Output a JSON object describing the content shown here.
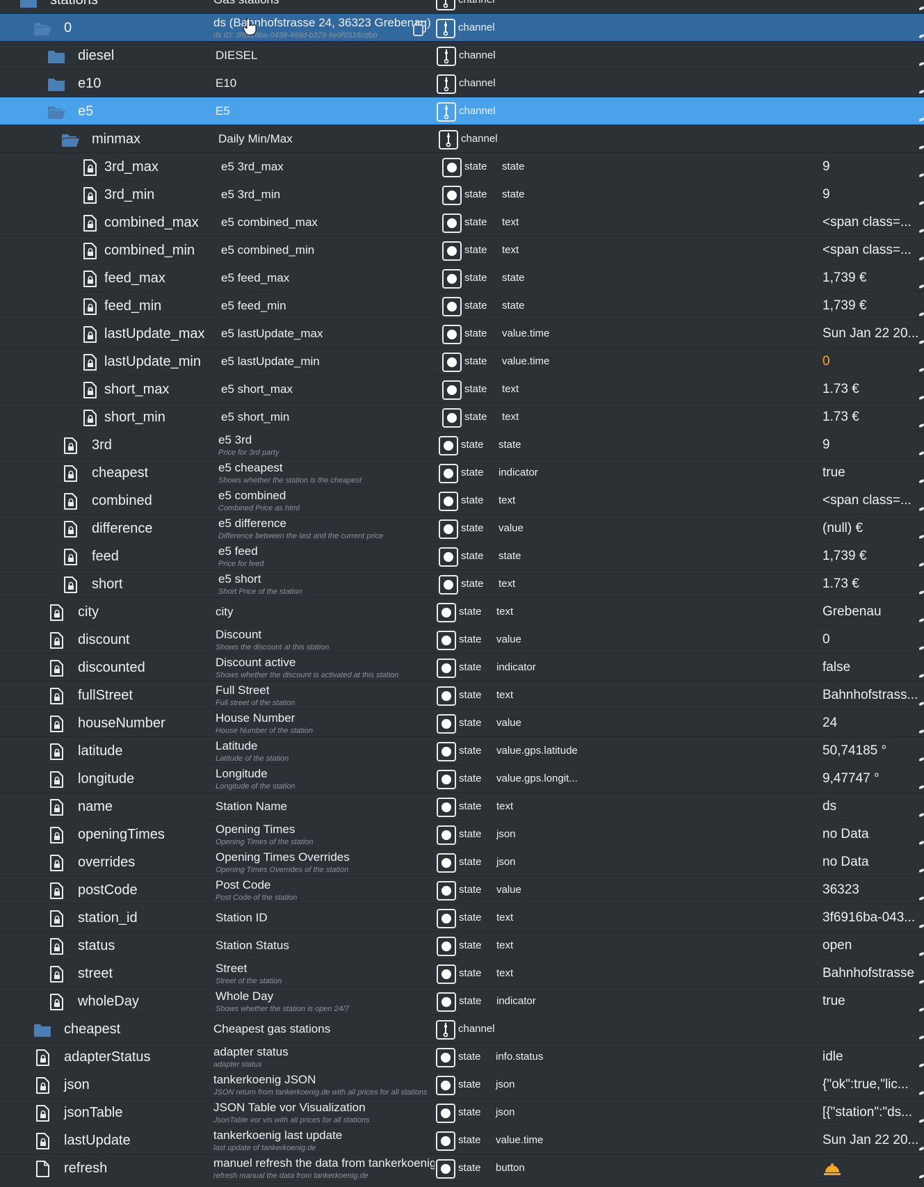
{
  "copy_icon": "copy-icon",
  "rows": [
    {
      "kind": "folder",
      "name": "stations",
      "title": "Gas stations",
      "desc": "",
      "role_type": "channel",
      "role": "",
      "value": "",
      "indent": 0
    },
    {
      "kind": "folder-open",
      "name": "0",
      "title": "ds (Bahnhofstrasse 24, 36323 Grebenau)",
      "desc": "ds ID: 3f6916ba-0438-469d-b379-6e9f0516cdbb",
      "role_type": "channel",
      "role": "",
      "value": "",
      "indent": 1,
      "selected": "dark"
    },
    {
      "kind": "folder",
      "name": "diesel",
      "title": "DIESEL",
      "desc": "",
      "role_type": "channel",
      "role": "",
      "value": "",
      "indent": 2
    },
    {
      "kind": "folder",
      "name": "e10",
      "title": "E10",
      "desc": "",
      "role_type": "channel",
      "role": "",
      "value": "",
      "indent": 2
    },
    {
      "kind": "folder-open",
      "name": "e5",
      "title": "E5",
      "desc": "",
      "role_type": "channel",
      "role": "",
      "value": "",
      "indent": 2,
      "selected": "light"
    },
    {
      "kind": "folder-open",
      "name": "minmax",
      "title": "Daily Min/Max",
      "desc": "",
      "role_type": "channel",
      "role": "",
      "value": "",
      "indent": 3
    },
    {
      "kind": "state",
      "name": "3rd_max",
      "title": "e5 3rd_max",
      "desc": "",
      "role_type": "state",
      "role": "state",
      "value": "9",
      "indent": 4
    },
    {
      "kind": "state",
      "name": "3rd_min",
      "title": "e5 3rd_min",
      "desc": "",
      "role_type": "state",
      "role": "state",
      "value": "9",
      "indent": 4
    },
    {
      "kind": "state",
      "name": "combined_max",
      "title": "e5 combined_max",
      "desc": "",
      "role_type": "state",
      "role": "text",
      "value": "<span class=...",
      "indent": 4
    },
    {
      "kind": "state",
      "name": "combined_min",
      "title": "e5 combined_min",
      "desc": "",
      "role_type": "state",
      "role": "text",
      "value": "<span class=...",
      "indent": 4
    },
    {
      "kind": "state",
      "name": "feed_max",
      "title": "e5 feed_max",
      "desc": "",
      "role_type": "state",
      "role": "state",
      "value": "1,739 €",
      "indent": 4
    },
    {
      "kind": "state",
      "name": "feed_min",
      "title": "e5 feed_min",
      "desc": "",
      "role_type": "state",
      "role": "state",
      "value": "1,739 €",
      "indent": 4
    },
    {
      "kind": "state",
      "name": "lastUpdate_max",
      "title": "e5 lastUpdate_max",
      "desc": "",
      "role_type": "state",
      "role": "value.time",
      "value": "Sun Jan 22 20...",
      "indent": 4
    },
    {
      "kind": "state",
      "name": "lastUpdate_min",
      "title": "e5 lastUpdate_min",
      "desc": "",
      "role_type": "state",
      "role": "value.time",
      "value": "0",
      "indent": 4,
      "value_color": "orange"
    },
    {
      "kind": "state",
      "name": "short_max",
      "title": "e5 short_max",
      "desc": "",
      "role_type": "state",
      "role": "text",
      "value": "1.73 €",
      "indent": 4
    },
    {
      "kind": "state",
      "name": "short_min",
      "title": "e5 short_min",
      "desc": "",
      "role_type": "state",
      "role": "text",
      "value": "1.73 €",
      "indent": 4
    },
    {
      "kind": "state",
      "name": "3rd",
      "title": "e5 3rd",
      "desc": "Price for 3rd party",
      "role_type": "state",
      "role": "state",
      "value": "9",
      "indent": 3
    },
    {
      "kind": "state",
      "name": "cheapest",
      "title": "e5 cheapest",
      "desc": "Shows whether the station is the cheapest",
      "role_type": "state",
      "role": "indicator",
      "value": "true",
      "indent": 3
    },
    {
      "kind": "state",
      "name": "combined",
      "title": "e5 combined",
      "desc": "Combined Price as html",
      "role_type": "state",
      "role": "text",
      "value": "<span class=...",
      "indent": 3
    },
    {
      "kind": "state",
      "name": "difference",
      "title": "e5 difference",
      "desc": "Difference between the last and the current price",
      "role_type": "state",
      "role": "value",
      "value": "(null) €",
      "indent": 3
    },
    {
      "kind": "state",
      "name": "feed",
      "title": "e5 feed",
      "desc": "Price for feed",
      "role_type": "state",
      "role": "state",
      "value": "1,739 €",
      "indent": 3
    },
    {
      "kind": "state",
      "name": "short",
      "title": "e5 short",
      "desc": "Short Price of the station",
      "role_type": "state",
      "role": "text",
      "value": "1.73 €",
      "indent": 3
    },
    {
      "kind": "state",
      "name": "city",
      "title": "city",
      "desc": "",
      "role_type": "state",
      "role": "text",
      "value": "Grebenau",
      "indent": 2
    },
    {
      "kind": "state",
      "name": "discount",
      "title": "Discount",
      "desc": "Shows the discount at this station",
      "role_type": "state",
      "role": "value",
      "value": "0",
      "indent": 2
    },
    {
      "kind": "state",
      "name": "discounted",
      "title": "Discount active",
      "desc": "Shows whether the discount is activated at this station",
      "role_type": "state",
      "role": "indicator",
      "value": "false",
      "indent": 2
    },
    {
      "kind": "state",
      "name": "fullStreet",
      "title": "Full Street",
      "desc": "Full street of the station",
      "role_type": "state",
      "role": "text",
      "value": "Bahnhofstrass...",
      "indent": 2
    },
    {
      "kind": "state",
      "name": "houseNumber",
      "title": "House Number",
      "desc": "House Number of the station",
      "role_type": "state",
      "role": "value",
      "value": "24",
      "indent": 2
    },
    {
      "kind": "state",
      "name": "latitude",
      "title": "Latitude",
      "desc": "Latitude of the station",
      "role_type": "state",
      "role": "value.gps.latitude",
      "value": "50,74185 °",
      "indent": 2
    },
    {
      "kind": "state",
      "name": "longitude",
      "title": "Longitude",
      "desc": "Longitude of the station",
      "role_type": "state",
      "role": "value.gps.longit...",
      "value": "9,47747 °",
      "indent": 2
    },
    {
      "kind": "state",
      "name": "name",
      "title": "Station Name",
      "desc": "",
      "role_type": "state",
      "role": "text",
      "value": "ds",
      "indent": 2
    },
    {
      "kind": "state",
      "name": "openingTimes",
      "title": "Opening Times",
      "desc": "Opening Times of the station",
      "role_type": "state",
      "role": "json",
      "value": "no Data",
      "indent": 2
    },
    {
      "kind": "state",
      "name": "overrides",
      "title": "Opening Times Overrides",
      "desc": "Opening Times Overrides of the station",
      "role_type": "state",
      "role": "json",
      "value": "no Data",
      "indent": 2
    },
    {
      "kind": "state",
      "name": "postCode",
      "title": "Post Code",
      "desc": "Post Code of the station",
      "role_type": "state",
      "role": "value",
      "value": "36323",
      "indent": 2
    },
    {
      "kind": "state",
      "name": "station_id",
      "title": "Station ID",
      "desc": "",
      "role_type": "state",
      "role": "text",
      "value": "3f6916ba-043...",
      "indent": 2
    },
    {
      "kind": "state",
      "name": "status",
      "title": "Station Status",
      "desc": "",
      "role_type": "state",
      "role": "text",
      "value": "open",
      "indent": 2
    },
    {
      "kind": "state",
      "name": "street",
      "title": "Street",
      "desc": "Street of the station",
      "role_type": "state",
      "role": "text",
      "value": "Bahnhofstrasse",
      "indent": 2
    },
    {
      "kind": "state",
      "name": "wholeDay",
      "title": "Whole Day",
      "desc": "Shows whether the station is open 24/7",
      "role_type": "state",
      "role": "indicator",
      "value": "true",
      "indent": 2
    },
    {
      "kind": "folder",
      "name": "cheapest",
      "title": "Cheapest gas stations",
      "desc": "",
      "role_type": "channel",
      "role": "",
      "value": "",
      "indent": 1
    },
    {
      "kind": "state",
      "name": "adapterStatus",
      "title": "adapter status",
      "desc": "adapter status",
      "role_type": "state",
      "role": "info.status",
      "value": "idle",
      "indent": 1
    },
    {
      "kind": "state",
      "name": "json",
      "title": "tankerkoenig JSON",
      "desc": "JSON return from tankerkoenig.de with all prices for all stations",
      "role_type": "state",
      "role": "json",
      "value": "{\"ok\":true,\"lic...",
      "indent": 1
    },
    {
      "kind": "state",
      "name": "jsonTable",
      "title": "JSON Table vor Visualization",
      "desc": "JsonTable vor vis with all prices for all stations",
      "role_type": "state",
      "role": "json",
      "value": "[{\"station\":\"ds...",
      "indent": 1
    },
    {
      "kind": "state",
      "name": "lastUpdate",
      "title": "tankerkoenig last update",
      "desc": "last update of tankerkoenig.de",
      "role_type": "state",
      "role": "value.time",
      "value": "Sun Jan 22 20...",
      "indent": 1
    },
    {
      "kind": "file",
      "name": "refresh",
      "title": "manuel refresh the data from tankerkoenig",
      "desc": "refresh manual the data from tankerkoenig.de",
      "role_type": "state",
      "role": "button",
      "value": "",
      "value_icon": "bell-icon",
      "indent": 1
    }
  ]
}
